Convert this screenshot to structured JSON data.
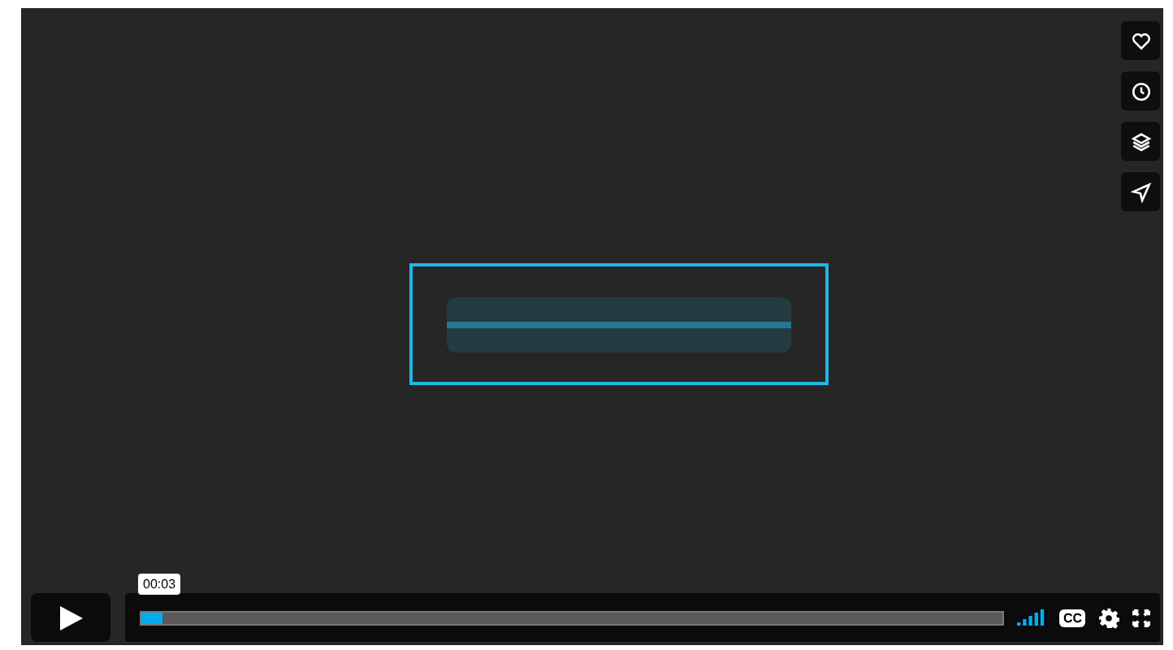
{
  "side_buttons": [
    {
      "kind": "heart"
    },
    {
      "kind": "clock"
    },
    {
      "kind": "layers"
    },
    {
      "kind": "send"
    }
  ],
  "controls": {
    "time_tooltip": "00:03",
    "progress": {
      "level": 0.025
    },
    "captions_label": "CC"
  }
}
